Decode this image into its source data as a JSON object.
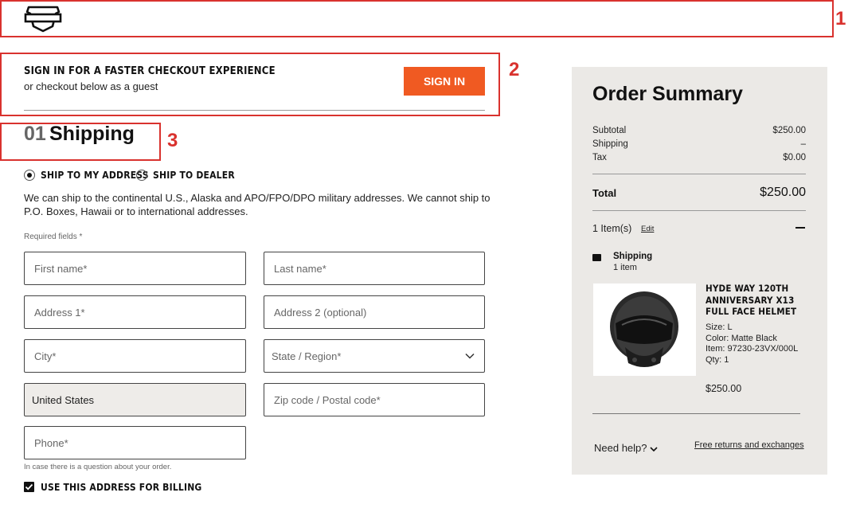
{
  "header": {
    "logo": "bar-and-shield-logo"
  },
  "annotations": [
    "1",
    "2",
    "3"
  ],
  "signin": {
    "title": "SIGN IN FOR A FASTER CHECKOUT EXPERIENCE",
    "subtitle": "or checkout below as a guest",
    "button": "SIGN IN"
  },
  "shipping": {
    "step": "01",
    "title": "Shipping",
    "options": [
      {
        "label": "SHIP TO MY ADDRESS",
        "selected": true
      },
      {
        "label": "SHIP TO DEALER",
        "selected": false
      }
    ],
    "info": "We can ship to the continental U.S., Alaska and APO/FPO/DPO military addresses. We cannot ship to P.O. Boxes, Hawaii or to international addresses.",
    "required_note": "Required fields *",
    "fields": {
      "first_name": "First name*",
      "last_name": "Last name*",
      "address1": "Address 1*",
      "address2": "Address 2 (optional)",
      "city": "City*",
      "state": "State / Region*",
      "country": "United States",
      "zip": "Zip code / Postal code*",
      "phone": "Phone*"
    },
    "phone_helper": "In case there is a question about your order.",
    "billing_checkbox": "USE THIS ADDRESS FOR BILLING",
    "billing_checked": true
  },
  "summary": {
    "title": "Order Summary",
    "rows": [
      {
        "label": "Subtotal",
        "value": "$250.00"
      },
      {
        "label": "Shipping",
        "value": "–"
      },
      {
        "label": "Tax",
        "value": "$0.00"
      }
    ],
    "total_label": "Total",
    "total_value": "$250.00",
    "items_count": "1 Item(s)",
    "edit": "Edit",
    "shipping_label": "Shipping",
    "shipping_count": "1 item",
    "product": {
      "name": "HYDE WAY 120TH ANNIVERSARY X13 FULL FACE HELMET",
      "size": "Size: L",
      "color": "Color: Matte Black",
      "item": "Item: 97230-23VX/000L",
      "qty": "Qty: 1",
      "price": "$250.00"
    },
    "need_help": "Need help?",
    "returns": "Free returns and exchanges"
  },
  "colors": {
    "accent": "#f05a22",
    "annotation": "#d9322e",
    "summary_bg": "#ebe9e6"
  }
}
